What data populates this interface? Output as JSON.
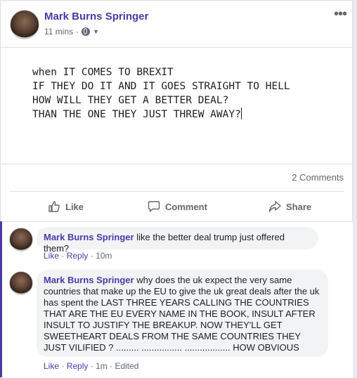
{
  "post": {
    "author": "Mark Burns Springer",
    "time": "11 mins",
    "more_label": "•••",
    "body_lines": [
      "when IT COMES TO BREXIT",
      "IF THEY DO IT AND IT GOES STRAIGHT TO HELL",
      "HOW WILL THEY GET A BETTER DEAL?",
      "THAN THE ONE THEY JUST THREW AWAY?"
    ],
    "comments_count": "2 Comments"
  },
  "actions": {
    "like": "Like",
    "comment": "Comment",
    "share": "Share"
  },
  "comments": [
    {
      "author": "Mark Burns Springer",
      "text": " like the better deal trump just offered them?",
      "like": "Like",
      "reply": "Reply",
      "time": "10m",
      "edited": ""
    },
    {
      "author": "Mark Burns Springer",
      "text": " why does the uk expect the very same countries that make up the EU to give the uk great deals after the uk has spent the LAST THREE YEARS CALLING THE COUNTRIES THAT ARE THE EU EVERY NAME IN THE BOOK, INSULT AFTER INSULT TO JUSTIFY THE BREAKUP. NOW THEY'LL GET SWEETHEART DEALS FROM THE SAME COUNTRIES THEY JUST VILIFIED ? ......... ................ .................. HOW OBVIOUS",
      "like": "Like",
      "reply": "Reply",
      "time": "1m",
      "edited": "Edited"
    }
  ],
  "colors": {
    "accent": "#4a3aa8",
    "muted": "#606770",
    "bubble": "#f2f3f5"
  }
}
